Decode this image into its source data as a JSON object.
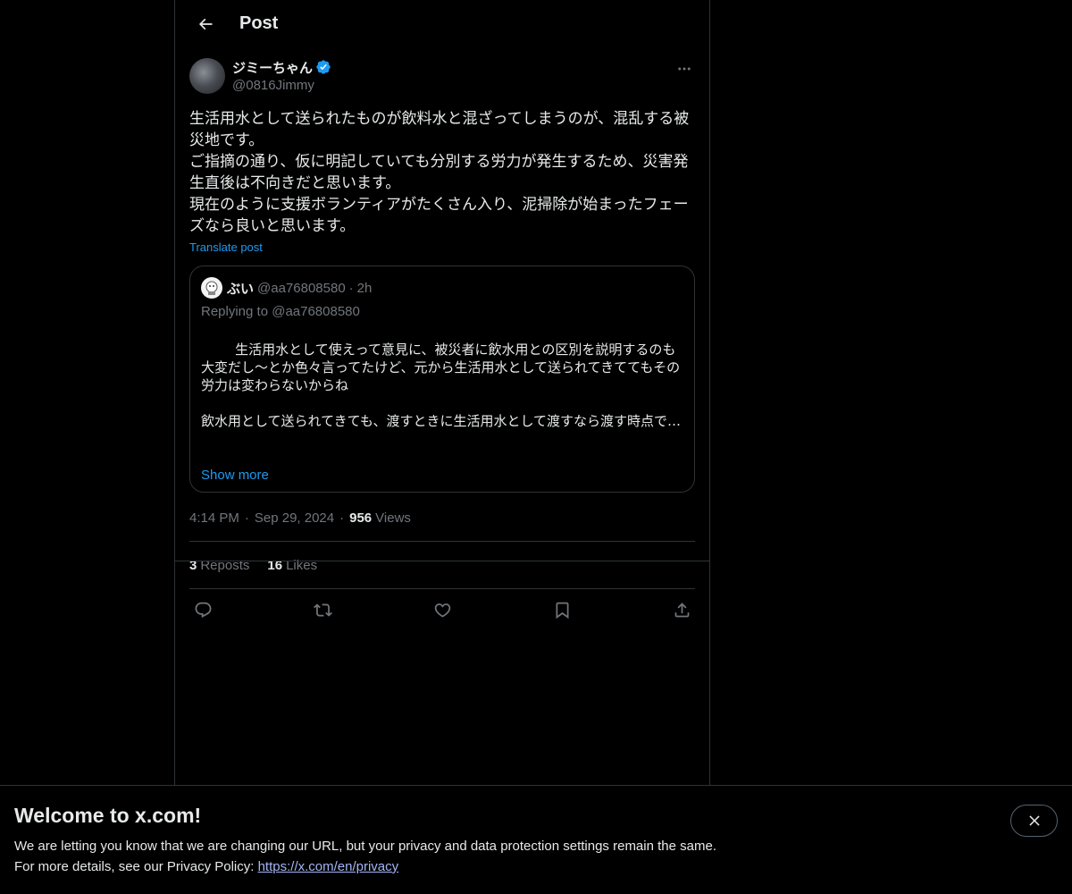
{
  "header": {
    "title": "Post"
  },
  "post": {
    "author": {
      "display_name": "ジミーちゃん",
      "handle": "@0816Jimmy"
    },
    "text": "生活用水として送られたものが飲料水と混ざってしまうのが、混乱する被災地です。\nご指摘の通り、仮に明記していても分別する労力が発生するため、災害発生直後は不向きだと思います。\n現在のように支援ボランティアがたくさん入り、泥掃除が始まったフェーズなら良いと思います。",
    "translate_label": "Translate post",
    "quote": {
      "display_name": "ぶい",
      "handle": "@aa76808580",
      "dot": "·",
      "time": "2h",
      "replying": "Replying to @aa76808580",
      "text": "生活用水として使えって意見に、被災者に飲水用との区別を説明するのも大変だし〜とか色々言ってたけど、元から生活用水として送られてきててもその労力は変わらないからね",
      "text_clipped": "飲水用として送られてきても、渡すときに生活用水として渡すなら渡す時点で…",
      "show_more": "Show more"
    },
    "time": "4:14 PM",
    "date": "Sep 29, 2024",
    "sep": "·",
    "views_count": "956",
    "views_label": "Views",
    "reposts_count": "3",
    "reposts_label": "Reposts",
    "likes_count": "16",
    "likes_label": "Likes"
  },
  "actions": [
    "reply-icon",
    "repost-icon",
    "like-icon",
    "bookmark-icon",
    "share-icon"
  ],
  "banner": {
    "title": "Welcome to x.com!",
    "line1": "We are letting you know that we are changing our URL, but your privacy and data protection settings remain the same.",
    "line2_prefix": "For more details, see our Privacy Policy: ",
    "link": "https://x.com/en/privacy"
  },
  "colors": {
    "accent": "#1d9bf0",
    "background": "#000000",
    "border": "#2f3336",
    "muted": "#71767b",
    "text": "#e7e9ea"
  }
}
